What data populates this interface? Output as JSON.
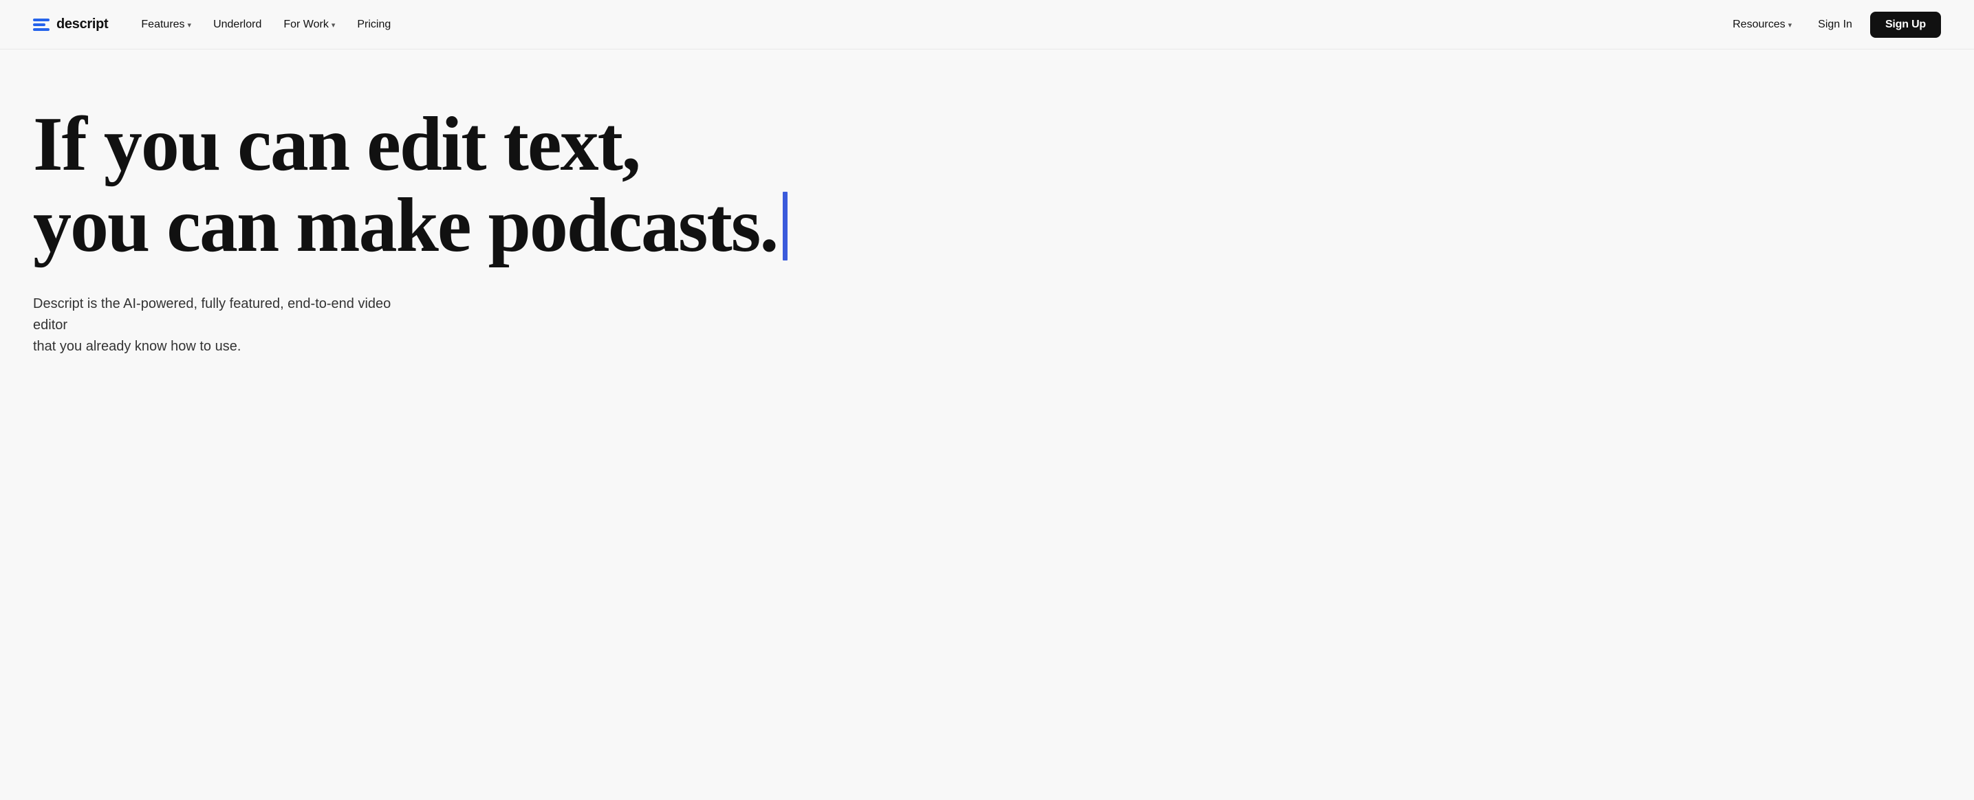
{
  "nav": {
    "logo": {
      "text": "descript"
    },
    "items": [
      {
        "label": "Features",
        "hasDropdown": true
      },
      {
        "label": "Underlord",
        "hasDropdown": false
      },
      {
        "label": "For Work",
        "hasDropdown": true
      },
      {
        "label": "Pricing",
        "hasDropdown": false
      }
    ],
    "right_items": [
      {
        "label": "Resources",
        "hasDropdown": true
      },
      {
        "label": "Sign In",
        "hasDropdown": false
      }
    ],
    "cta": "Sign Up"
  },
  "hero": {
    "headline_line1": "If you can edit text,",
    "headline_line2": "you can make podcasts.",
    "subtext_line1": "Descript is the AI-powered, fully featured, end-to-end video editor",
    "subtext_line2": "that you already know how to use."
  },
  "colors": {
    "cursor": "#3b5bdb",
    "logo_icon": "#2563eb",
    "cta_bg": "#111111",
    "text_primary": "#111111"
  }
}
